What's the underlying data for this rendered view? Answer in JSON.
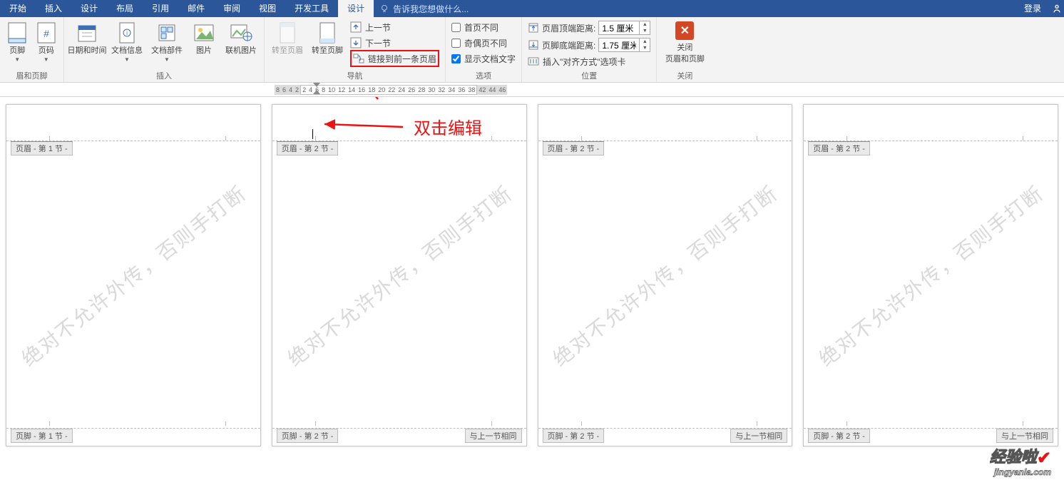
{
  "menu": {
    "tabs": [
      "开始",
      "插入",
      "设计",
      "布局",
      "引用",
      "邮件",
      "审阅",
      "视图",
      "开发工具",
      "设计"
    ],
    "activeIndex": 9,
    "tellMe": "告诉我您想做什么...",
    "login": "登录"
  },
  "ribbon": {
    "groups": {
      "headerFooter": {
        "label": "眉和页脚",
        "header": "页脚",
        "pageNum": "页码"
      },
      "insert": {
        "label": "插入",
        "dateTime": "日期和时间",
        "docInfo": "文档信息",
        "docParts": "文档部件",
        "picture": "图片",
        "onlinePic": "联机图片"
      },
      "nav": {
        "label": "导航",
        "goHeader": "转至页眉",
        "goFooter": "转至页脚",
        "prev": "上一节",
        "next": "下一节",
        "linkPrev": "链接到前一条页眉"
      },
      "options": {
        "label": "选项",
        "diffFirst": "首页不同",
        "diffOdd": "奇偶页不同",
        "showDoc": "显示文档文字",
        "showDocChecked": true
      },
      "position": {
        "label": "位置",
        "topLbl": "页眉顶端距离:",
        "topVal": "1.5 厘米",
        "botLbl": "页脚底端距离:",
        "botVal": "1.75 厘米",
        "alignTab": "插入\"对齐方式\"选项卡"
      },
      "close": {
        "label": "关闭",
        "btn": "关闭\n页眉和页脚"
      }
    }
  },
  "ruler": {
    "left": [
      "8",
      "6",
      "4",
      "2"
    ],
    "mid": [
      "2",
      "4",
      "6",
      "8",
      "10",
      "12",
      "14",
      "16",
      "18",
      "20",
      "22",
      "24",
      "26",
      "28",
      "30",
      "32",
      "34",
      "36",
      "38"
    ],
    "right": [
      "42",
      "44",
      "46"
    ]
  },
  "pages": [
    {
      "header": "页眉 - 第 1 节 -",
      "footerL": "页脚 - 第 1 节 -",
      "footerR": "",
      "cursor": false
    },
    {
      "header": "页眉 - 第 2 节 -",
      "footerL": "页脚 - 第 2 节 -",
      "footerR": "与上一节相同",
      "cursor": true
    },
    {
      "header": "页眉 - 第 2 节 -",
      "footerL": "页脚 - 第 2 节 -",
      "footerR": "与上一节相同",
      "cursor": false
    },
    {
      "header": "页眉 - 第 2 节 -",
      "footerL": "页脚 - 第 2 节 -",
      "footerR": "与上一节相同",
      "cursor": false
    }
  ],
  "watermarkText": "绝对不允许外传，否则手打断",
  "annotation": {
    "dblClick": "双击编辑"
  },
  "site": {
    "name": "经验啦",
    "url": "jingyanla.com"
  }
}
